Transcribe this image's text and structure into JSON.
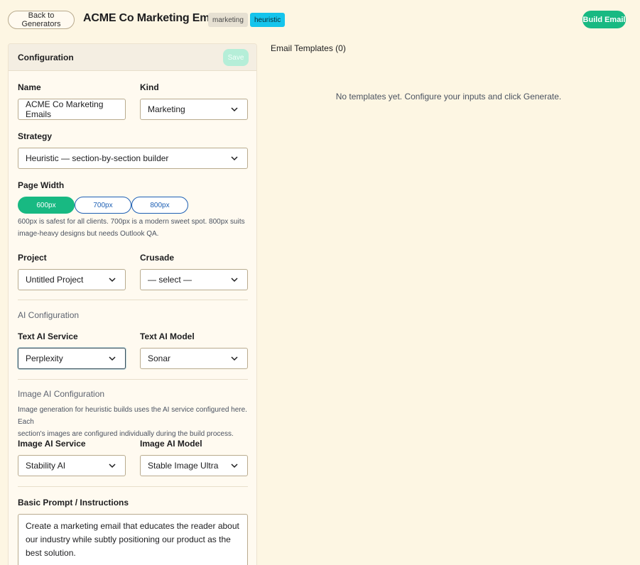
{
  "header": {
    "back_label": "Back to Generators",
    "title": "ACME Co Marketing Emails",
    "badges": [
      "marketing",
      "heuristic"
    ],
    "build_label": "Build Email"
  },
  "config": {
    "title": "Configuration",
    "save_label": "Save",
    "name": {
      "label": "Name",
      "value": "ACME Co Marketing Emails"
    },
    "kind": {
      "label": "Kind",
      "value": "Marketing"
    },
    "strategy": {
      "label": "Strategy",
      "value": "Heuristic — section-by-section builder"
    },
    "page_width": {
      "label": "Page Width",
      "options": [
        "600px",
        "700px",
        "800px"
      ],
      "selected": "600px",
      "hint_line1": "600px is safest for all clients. 700px is a modern sweet spot. 800px suits",
      "hint_line2": "image-heavy designs but needs Outlook QA."
    },
    "project": {
      "label": "Project",
      "value": "Untitled Project"
    },
    "crusade": {
      "label": "Crusade",
      "value": "— select —"
    },
    "ai_section": "AI Configuration",
    "text_ai_service": {
      "label": "Text AI Service",
      "value": "Perplexity"
    },
    "text_ai_model": {
      "label": "Text AI Model",
      "value": "Sonar"
    },
    "image_ai_section": "Image AI Configuration",
    "image_ai_hint_line1": "Image generation for heuristic builds uses the AI service configured here. Each",
    "image_ai_hint_line2": "section's images are configured individually during the build process.",
    "image_ai_service": {
      "label": "Image AI Service",
      "value": "Stability AI"
    },
    "image_ai_model": {
      "label": "Image AI Model",
      "value": "Stable Image Ultra"
    },
    "prompt": {
      "label": "Basic Prompt / Instructions",
      "value": "Create a marketing email that educates the reader about our industry while subtly positioning our product as the best solution."
    }
  },
  "templates": {
    "title": "Email Templates (0)",
    "empty_message": "No templates yet. Configure your inputs and click Generate."
  },
  "colors": {
    "background": "#fdf6e3",
    "accent": "#18b982",
    "badge_heuristic": "#15c4ec",
    "link_blue": "#1d5fb4"
  }
}
